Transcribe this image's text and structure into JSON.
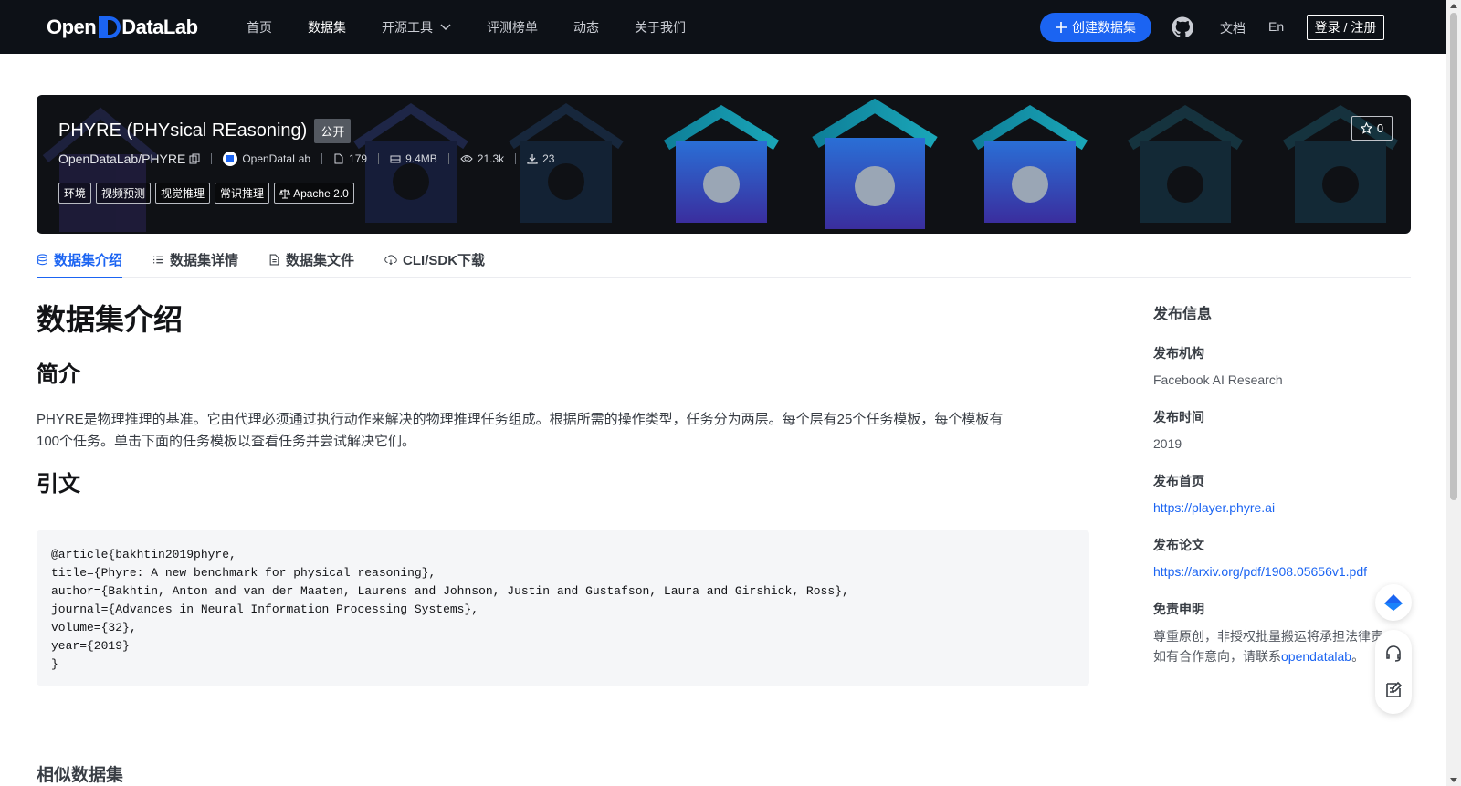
{
  "nav": {
    "logo": {
      "open": "Open",
      "data": "DataLab"
    },
    "items": [
      {
        "label": "首页"
      },
      {
        "label": "数据集",
        "active": true
      },
      {
        "label": "开源工具",
        "dropdown": true
      },
      {
        "label": "评测榜单"
      },
      {
        "label": "动态"
      },
      {
        "label": "关于我们"
      }
    ],
    "create_label": "创建数据集",
    "docs_label": "文档",
    "lang_label": "En",
    "login_label": "登录 / 注册"
  },
  "banner": {
    "title": "PHYRE (PHYsical REasoning)",
    "visibility": "公开",
    "repo": "OpenDataLab/PHYRE",
    "org": "OpenDataLab",
    "files": "179",
    "size": "9.4MB",
    "views": "21.3k",
    "downloads": "23",
    "tags": [
      "环境",
      "视频预测",
      "视觉推理",
      "常识推理"
    ],
    "license": "Apache 2.0",
    "stars": "0"
  },
  "tabs": [
    {
      "label": "数据集介绍",
      "active": true,
      "icon": "database-icon"
    },
    {
      "label": "数据集详情",
      "icon": "list-icon"
    },
    {
      "label": "数据集文件",
      "icon": "file-icon"
    },
    {
      "label": "CLI/SDK下载",
      "icon": "cloud-download-icon"
    }
  ],
  "content": {
    "heading": "数据集介绍",
    "intro_heading": "简介",
    "intro_line1": "PHYRE是物理推理的基准。它由代理必须通过执行动作来解决的物理推理任务组成。根据所需的操作类型，任务分为两层。每个层有25个任务模板，每个模板有",
    "intro_line2": "100个任务。单击下面的任务模板以查看任务并尝试解决它们。",
    "citation_heading": "引文",
    "citation": "@article{bakhtin2019phyre,\ntitle={Phyre: A new benchmark for physical reasoning},\nauthor={Bakhtin, Anton and van der Maaten, Laurens and Johnson, Justin and Gustafson, Laura and Girshick, Ross},\njournal={Advances in Neural Information Processing Systems},\nvolume={32},\nyear={2019}\n}",
    "similar_heading": "相似数据集"
  },
  "sidebar": {
    "title": "发布信息",
    "org_label": "发布机构",
    "org_value": "Facebook AI Research",
    "time_label": "发布时间",
    "time_value": "2019",
    "home_label": "发布首页",
    "home_value": "https://player.phyre.ai",
    "paper_label": "发布论文",
    "paper_value": "https://arxiv.org/pdf/1908.05656v1.pdf",
    "disclaimer_label": "免责申明",
    "disclaimer_line1": "尊重原创，非授权批量搬运将承担法律责",
    "disclaimer_line2_prefix": "如有合作意向，请联系",
    "disclaimer_link": "opendatalab",
    "disclaimer_suffix": "。"
  },
  "colors": {
    "nav_bg": "#0d1117",
    "accent": "#1b64f2",
    "banner_bg": "#0f1115",
    "code_bg": "#f5f6f8"
  }
}
